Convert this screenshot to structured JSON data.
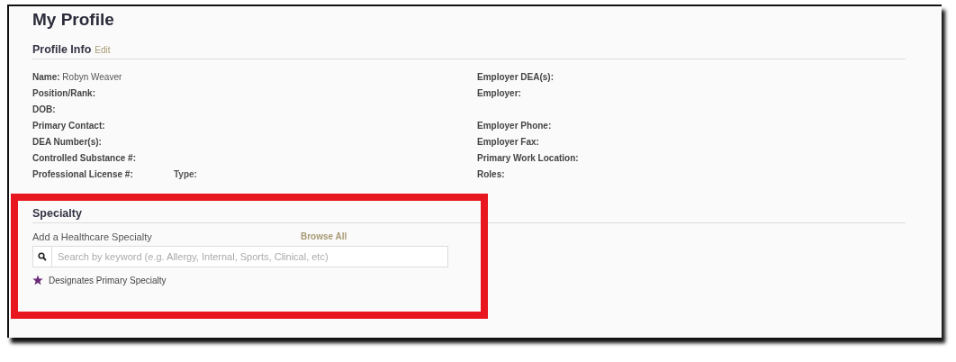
{
  "title": "My Profile",
  "profile_info": {
    "heading": "Profile Info",
    "edit_link": "Edit",
    "rows": [
      {
        "left": {
          "label": "Name:",
          "value": "Robyn Weaver"
        },
        "right": {
          "label": "Employer DEA(s):"
        }
      },
      {
        "left": {
          "label": "Position/Rank:"
        },
        "right": {
          "label": "Employer:"
        }
      },
      {
        "left": {
          "label": "DOB:"
        }
      },
      {
        "left": {
          "label": "Primary Contact:"
        },
        "right": {
          "label": "Employer Phone:"
        }
      },
      {
        "left": {
          "label": "DEA Number(s):"
        },
        "right": {
          "label": "Employer Fax:"
        }
      },
      {
        "left": {
          "label": "Controlled Substance #:"
        },
        "right": {
          "label": "Primary Work Location:"
        }
      },
      {
        "left": {
          "label": "Professional License #:",
          "extra_label": "Type:"
        },
        "right": {
          "label": "Roles:"
        }
      }
    ]
  },
  "specialty": {
    "heading": "Specialty",
    "add_label": "Add a Healthcare Specialty",
    "browse_link": "Browse All",
    "search": {
      "placeholder": "Search by keyword (e.g. Allergy, Internal, Sports, Clinical, etc)"
    },
    "legend": "Designates Primary Specialty"
  }
}
